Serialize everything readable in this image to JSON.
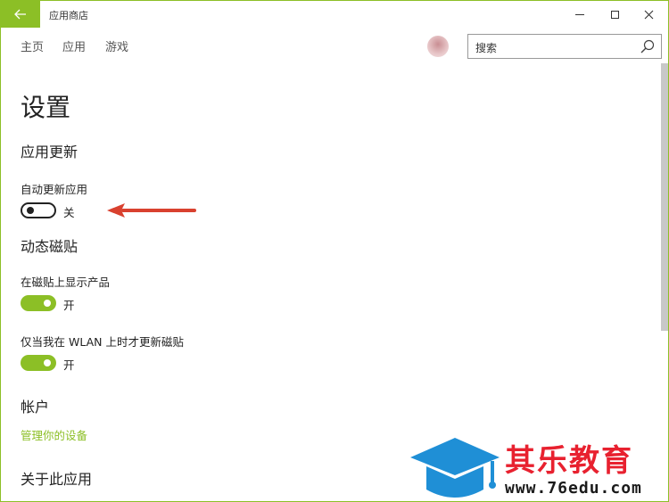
{
  "window": {
    "title": "应用商店",
    "back_icon": "arrow-left-icon",
    "accent_color": "#8cbf26"
  },
  "nav": {
    "items": [
      {
        "label": "主页"
      },
      {
        "label": "应用"
      },
      {
        "label": "游戏"
      }
    ]
  },
  "search": {
    "text": "搜索"
  },
  "page": {
    "title": "设置"
  },
  "sections": {
    "app_updates": {
      "heading": "应用更新",
      "auto_update_label": "自动更新应用",
      "auto_update_state": "关",
      "auto_update_on": false
    },
    "live_tiles": {
      "heading": "动态磁贴",
      "show_products_label": "在磁贴上显示产品",
      "show_products_state": "开",
      "show_products_on": true,
      "wlan_only_label": "仅当我在 WLAN 上时才更新磁贴",
      "wlan_only_state": "开",
      "wlan_only_on": true
    },
    "account": {
      "heading": "帐户",
      "manage_devices_link": "管理你的设备"
    },
    "about": {
      "heading": "关于此应用"
    }
  },
  "watermark": {
    "brand": "其乐教育",
    "url": "www.76edu.com",
    "color": "#e8212f",
    "logo_color": "#1f8fd6"
  }
}
